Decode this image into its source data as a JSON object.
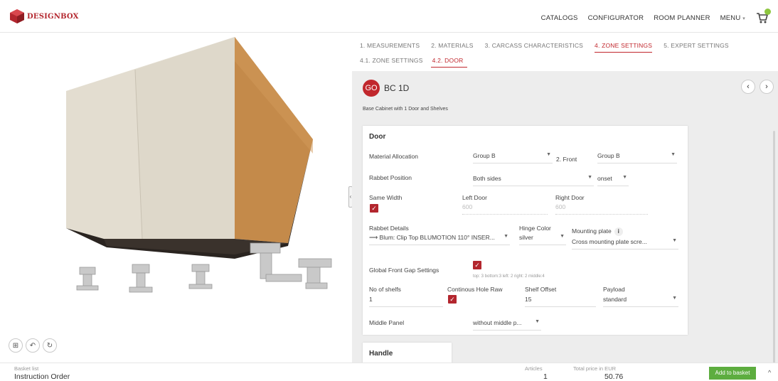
{
  "brand": {
    "logo_text": "DESIGNBOX",
    "accent": "#c1272d"
  },
  "nav": {
    "items": [
      "CATALOGS",
      "CONFIGURATOR",
      "ROOM PLANNER",
      "MENU"
    ],
    "menu_caret": "▾",
    "cart_icon": "cart-icon"
  },
  "viewer": {
    "tools": [
      "⊞",
      "↶",
      "↻"
    ],
    "handle": "‹"
  },
  "tabs": [
    {
      "label": "1. MEASUREMENTS"
    },
    {
      "label": "2. MATERIALS"
    },
    {
      "label": "3. CARCASS CHARACTERISTICS"
    },
    {
      "label": "4. ZONE SETTINGS"
    },
    {
      "label": "5. EXPERT SETTINGS"
    }
  ],
  "subtabs": [
    {
      "label": "4.1. ZONE SETTINGS"
    },
    {
      "label": "4.2. DOOR"
    }
  ],
  "item": {
    "badge": "GO",
    "code": "BC 1D",
    "description": "Base Cabinet with 1 Door and Shelves",
    "prev": "‹",
    "next": "›"
  },
  "door": {
    "title": "Door",
    "material_allocation": {
      "label": "Material Allocation",
      "value": "Group B",
      "front_label": "2. Front",
      "front_value": "Group B"
    },
    "rabbet_position": {
      "label": "Rabbet Position",
      "value": "Both sides",
      "onset": "onset"
    },
    "same_width": {
      "label": "Same Width",
      "checked": true
    },
    "left_door": {
      "label": "Left Door",
      "value": "600"
    },
    "right_door": {
      "label": "Right Door",
      "value": "600"
    },
    "rabbet_details": {
      "label": "Rabbet Details",
      "value": "⟶ Blum: Clip Top BLUMOTION 110° INSER..."
    },
    "hinge_color": {
      "label": "Hinge Color",
      "value": "silver"
    },
    "mounting_plate": {
      "label": "Mounting plate",
      "info": "i",
      "value": "Cross mounting plate scre..."
    },
    "global_gap": {
      "label": "Global Front Gap Settings",
      "checked": true,
      "hint": "top: 3 bottom:3 left: 2 right: 2 middle:4"
    },
    "no_of_shelfs": {
      "label": "No of shelfs",
      "value": "1"
    },
    "continous_hole_raw": {
      "label": "Continous Hole Raw",
      "checked": true
    },
    "shelf_offset": {
      "label": "Shelf Offset",
      "value": "15"
    },
    "payload": {
      "label": "Payload",
      "value": "standard"
    },
    "middle_panel": {
      "label": "Middle Panel",
      "value": "without middle p..."
    }
  },
  "handle": {
    "title": "Handle"
  },
  "footer": {
    "basket_label": "Basket list",
    "basket_value": "Instruction Order",
    "articles_label": "Articles",
    "articles_value": "1",
    "price_label": "Total price in EUR",
    "price_value": "50.76",
    "add_button": "Add to basket",
    "expand": "^"
  }
}
